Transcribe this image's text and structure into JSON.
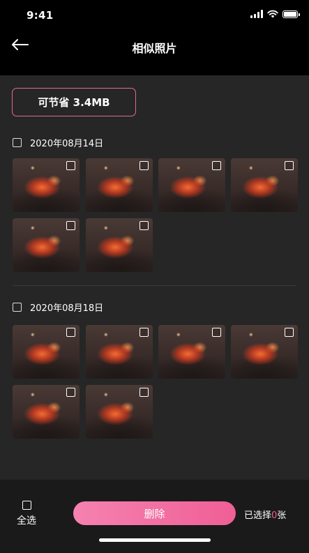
{
  "status_bar": {
    "time": "9:41"
  },
  "header": {
    "title": "相似照片"
  },
  "savings": {
    "label": "可节省 3.4MB"
  },
  "groups": [
    {
      "date": "2020年08月14日",
      "photo_count": 6
    },
    {
      "date": "2020年08月18日",
      "photo_count": 6
    }
  ],
  "footer": {
    "select_all_label": "全选",
    "delete_label": "删除",
    "selected_prefix": "已选择",
    "selected_count": "0",
    "selected_suffix": "张"
  },
  "colors": {
    "accent": "#ef5f96",
    "background": "#262626",
    "bar": "#000000"
  }
}
